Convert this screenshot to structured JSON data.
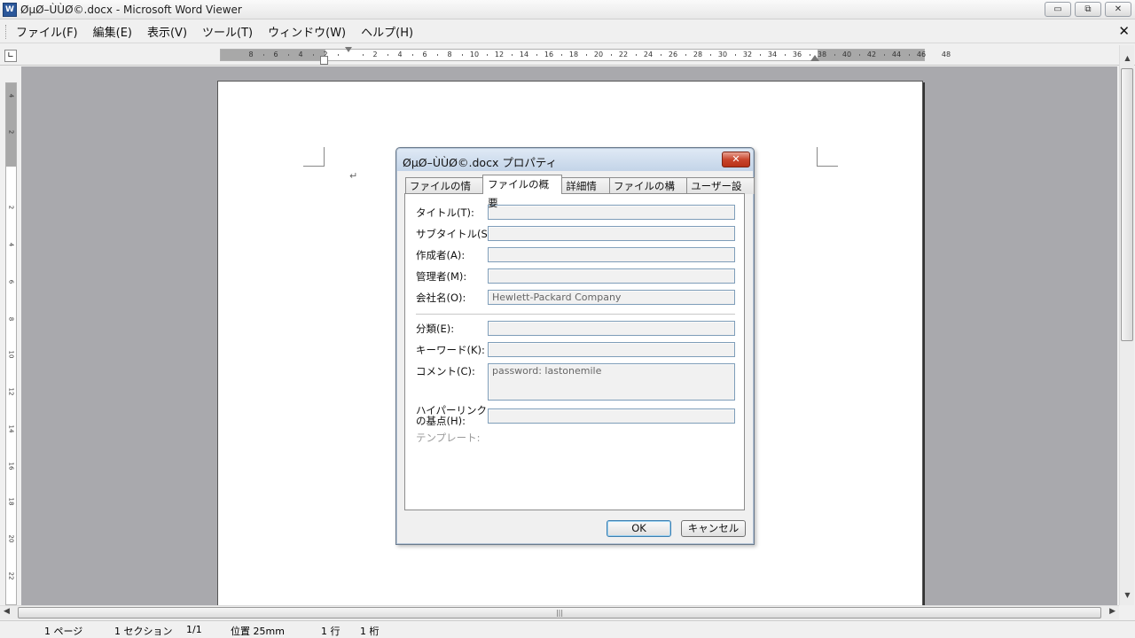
{
  "window": {
    "title": "ØµØ–ÙÙØ©.docx - Microsoft Word Viewer",
    "app_icon": "W",
    "minimize": "▭",
    "maximize": "⧉",
    "close": "✕"
  },
  "menubar": {
    "items": [
      "ファイル(F)",
      "編集(E)",
      "表示(V)",
      "ツール(T)",
      "ウィンドウ(W)",
      "ヘルプ(H)"
    ],
    "close_doc": "✕"
  },
  "ruler": {
    "tab_selector": "∟",
    "left_labels": [
      "8",
      "6",
      "4",
      "2"
    ],
    "right_labels": [
      "2",
      "4",
      "6",
      "8",
      "10",
      "12",
      "14",
      "16",
      "18",
      "20",
      "22",
      "24",
      "26",
      "28",
      "30",
      "32",
      "34",
      "36",
      "38",
      "40",
      "42",
      "44",
      "46",
      "48"
    ],
    "vertical_labels": [
      "4",
      "2",
      "2",
      "4",
      "6",
      "8",
      "10",
      "12",
      "14",
      "16",
      "18",
      "20",
      "22"
    ]
  },
  "document": {
    "paragraph_mark": "↵"
  },
  "scrollbars": {
    "up": "▲",
    "down": "▼",
    "left": "◀",
    "right": "▶",
    "grip": "|||"
  },
  "status": {
    "page": "1 ページ",
    "section": "1 セクション",
    "page_of": "1/1",
    "position": "位置  25mm",
    "line": "1 行",
    "column": "1 桁"
  },
  "dialog": {
    "title": "ØµØ–ÙÙØ©.docx プロパティ",
    "close": "✕",
    "tabs": [
      "ファイルの情報",
      "ファイルの概要",
      "詳細情報",
      "ファイルの構成",
      "ユーザー設定"
    ],
    "active_tab": 1,
    "fields": {
      "title_label": "タイトル(T):",
      "title_value": "",
      "subtitle_label": "サブタイトル(S):",
      "subtitle_value": "",
      "author_label": "作成者(A):",
      "author_value": "",
      "manager_label": "管理者(M):",
      "manager_value": "",
      "company_label": "会社名(O):",
      "company_value": "Hewlett-Packard Company",
      "category_label": "分類(E):",
      "category_value": "",
      "keywords_label": "キーワード(K):",
      "keywords_value": "",
      "comments_label": "コメント(C):",
      "comments_value": "password: lastonemile",
      "hyperlink_label_1": "ハイパーリンク",
      "hyperlink_label_2": "の基点(H):",
      "hyperlink_value": "",
      "template_label": "テンプレート:"
    },
    "ok_label": "OK",
    "cancel_label": "キャンセル"
  }
}
